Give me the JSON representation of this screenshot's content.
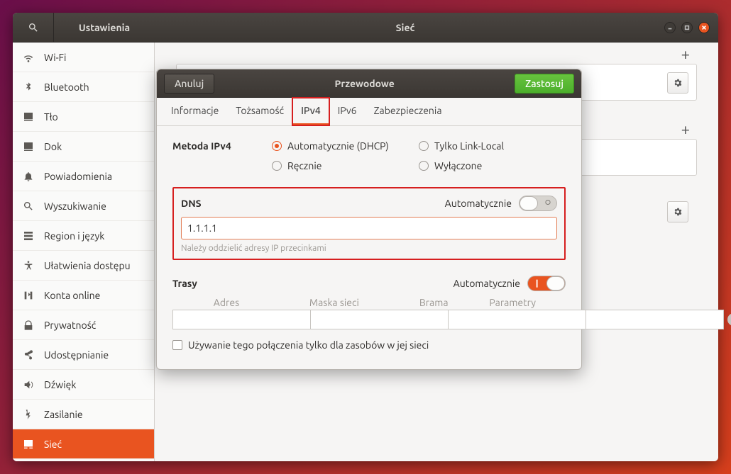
{
  "titlebar": {
    "app": "Ustawienia",
    "page": "Sieć"
  },
  "sidebar": {
    "items": [
      {
        "label": "Wi-Fi",
        "icon": "wifi"
      },
      {
        "label": "Bluetooth",
        "icon": "bluetooth"
      },
      {
        "label": "Tło",
        "icon": "background"
      },
      {
        "label": "Dok",
        "icon": "dock"
      },
      {
        "label": "Powiadomienia",
        "icon": "bell"
      },
      {
        "label": "Wyszukiwanie",
        "icon": "search"
      },
      {
        "label": "Region i język",
        "icon": "region"
      },
      {
        "label": "Ułatwienia dostępu",
        "icon": "accessibility"
      },
      {
        "label": "Konta online",
        "icon": "accounts"
      },
      {
        "label": "Prywatność",
        "icon": "privacy"
      },
      {
        "label": "Udostępnianie",
        "icon": "sharing"
      },
      {
        "label": "Dźwięk",
        "icon": "sound"
      },
      {
        "label": "Zasilanie",
        "icon": "power"
      },
      {
        "label": "Sieć",
        "icon": "network",
        "active": true
      }
    ]
  },
  "dialog": {
    "cancel": "Anuluj",
    "title": "Przewodowe",
    "apply": "Zastosuj",
    "tabs": [
      "Informacje",
      "Tożsamość",
      "IPv4",
      "IPv6",
      "Zabezpieczenia"
    ],
    "active_tab": "IPv4",
    "method_label": "Metoda IPv4",
    "methods": {
      "auto": "Automatycznie (DHCP)",
      "linklocal": "Tylko Link-Local",
      "manual": "Ręcznie",
      "off": "Wyłączone"
    },
    "method_selected": "auto",
    "dns": {
      "label": "DNS",
      "auto_label": "Automatycznie",
      "auto": false,
      "value": "1.1.1.1",
      "hint": "Należy oddzielić adresy IP przecinkami"
    },
    "routes": {
      "label": "Trasy",
      "auto_label": "Automatycznie",
      "auto": true,
      "cols": {
        "addr": "Adres",
        "mask": "Maska sieci",
        "gw": "Brama",
        "metric": "Parametry"
      },
      "only_resources": "Używanie tego połączenia tylko dla zasobów w jej sieci"
    }
  }
}
